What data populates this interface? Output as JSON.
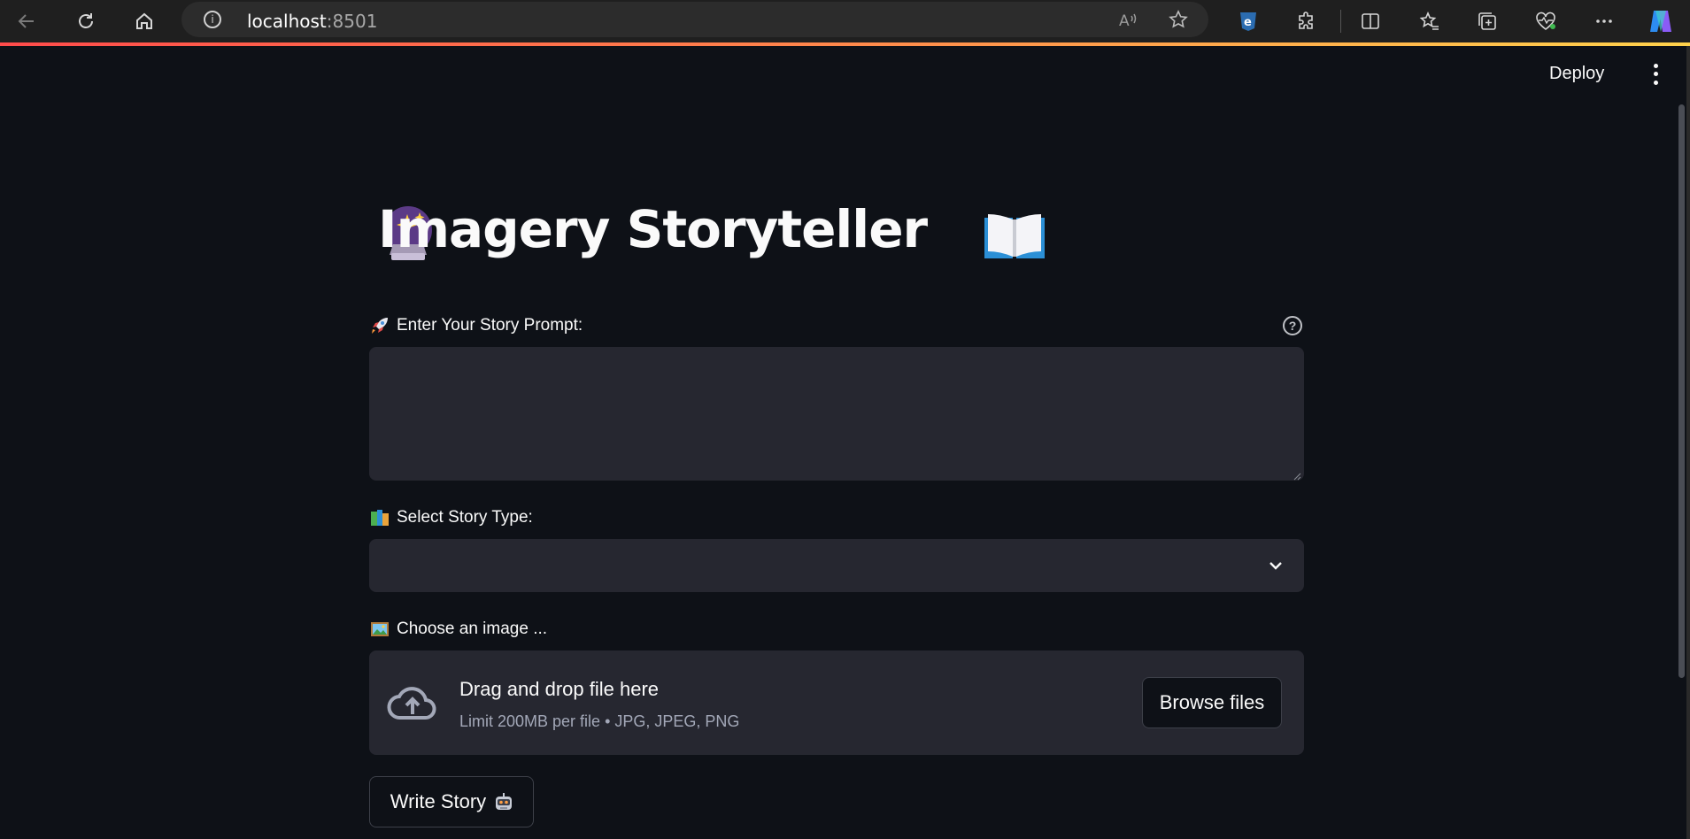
{
  "browser": {
    "url_host": "localhost",
    "url_port": ":8501",
    "icons": [
      "back-arrow-icon",
      "refresh-icon",
      "home-icon",
      "info-icon",
      "read-aloud-icon",
      "favorite-star-icon",
      "extension-icon",
      "puzzle-icon",
      "split-screen-icon",
      "favorites-icon",
      "collections-icon",
      "browser-essentials-icon",
      "more-icon",
      "copilot-icon"
    ]
  },
  "header": {
    "deploy_label": "Deploy"
  },
  "main": {
    "title": "Imagery Storyteller",
    "title_icons": [
      "crystal-ball-icon",
      "open-book-icon"
    ],
    "prompt": {
      "label": "Enter Your Story Prompt:",
      "icon": "rocket-icon",
      "value": "",
      "placeholder": ""
    },
    "story_type": {
      "label": "Select Story Type:",
      "icon": "books-icon",
      "selected": ""
    },
    "image_upload": {
      "label": "Choose an image ...",
      "icon": "framed-picture-icon",
      "drop_text": "Drag and drop file here",
      "limit_text": "Limit 200MB per file • JPG, JPEG, PNG",
      "browse_label": "Browse files"
    },
    "write_button": {
      "label": "Write Story",
      "icon": "robot-icon"
    }
  },
  "colors": {
    "app_background": "#0e1117",
    "input_background": "#262730",
    "text": "#fafafa",
    "muted_text": "#a3a8b8",
    "accent": "#ff4b4b"
  }
}
